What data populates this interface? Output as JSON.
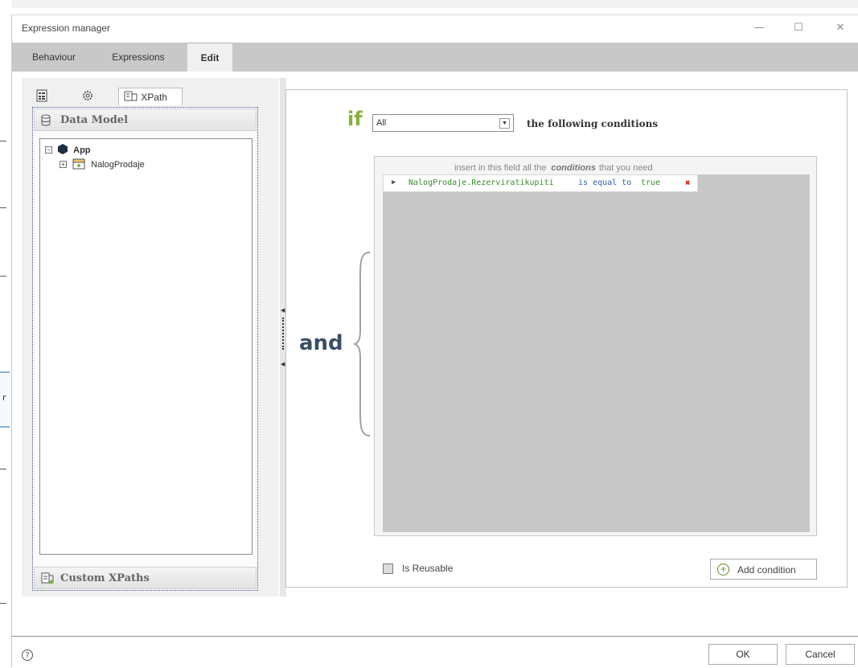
{
  "window": {
    "title": "Expression manager"
  },
  "tabs": [
    {
      "label": "Behaviour"
    },
    {
      "label": "Expressions"
    },
    {
      "label": "Edit"
    }
  ],
  "left_panel": {
    "xpath_tab_label": "XPath",
    "data_model_header": "Data Model",
    "custom_xpaths_header": "Custom XPaths",
    "tree": [
      {
        "label": "App",
        "icon": "app-icon"
      },
      {
        "label": "NalogProdaje",
        "icon": "entity-icon"
      }
    ]
  },
  "expression": {
    "if_label": "if",
    "match_select_value": "All",
    "following_label": "the following conditions",
    "and_label": "and",
    "hint_prefix": "insert in this field all the",
    "hint_emphasis": "conditions",
    "hint_suffix": "that you need",
    "conditions": [
      {
        "field": "NalogProdaje.Rezerviratikupiti",
        "operator": "is equal to",
        "value": "true"
      }
    ],
    "reusable_label": "Is Reusable",
    "add_condition_label": "Add condition"
  },
  "footer": {
    "help_symbol": "?",
    "ok_label": "OK",
    "cancel_label": "Cancel"
  },
  "background": {
    "edge_glyph": "r"
  }
}
